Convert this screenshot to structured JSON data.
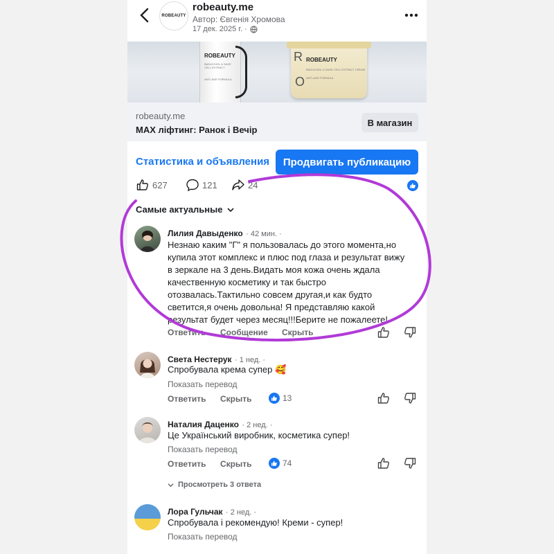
{
  "header": {
    "page_name": "robeauty.me",
    "author": "Автор: Євгенія Хромова",
    "date": "17 дек. 2025 г. ·",
    "logo_text": "ROBEAUTY"
  },
  "banner": {
    "tube_brand": "ROBEAUTY",
    "tube_line1": "BAKUCHIOL & SAGE CELL EXTRACT",
    "tube_line2": "ANTI-AGE FORMULA",
    "jar_brand": "ROBEAUTY",
    "jar_line1": "BAKUCHIOL & SAGE CELL EXTRACT CREAM",
    "jar_line2": "ANTI-AGE FORMULA",
    "jar_letters": [
      "R",
      "O"
    ]
  },
  "link_card": {
    "domain": "robeauty.me",
    "title": "MAX ліфтинг: Ранок і Вечір",
    "button": "В магазин"
  },
  "actions": {
    "stats_link": "Статистика и объявления",
    "promote_button": "Продвигать публикацию"
  },
  "reactions": {
    "likes": "627",
    "comments": "121",
    "shares": "24"
  },
  "sort_label": "Самые актуальные",
  "comments": [
    {
      "name": "Лилия Давыденко",
      "time": "· 42 мин. ·",
      "lines": [
        "Незнаю каким \"Г\" я пользовалась до этого момента,но",
        "купила этот комплекс и плюс под глаза и результат вижу",
        "в зеркале на 3 день.Видать моя кожа очень ждала",
        "качественную косметику и так быстро",
        "отозвалась.Тактильно совсем другая,и как будто",
        "светится,я очень довольна! Я представляю какой",
        "результат будет через месяц!!!Берите не пожалеете!"
      ],
      "actions": [
        "Ответить",
        "Сообщение",
        "Скрыть"
      ]
    },
    {
      "name": "Света Нестерук",
      "time": "· 1 нед. ·",
      "text": "Спробувала крема супер 🥰",
      "translate": "Показать перевод",
      "actions": [
        "Ответить",
        "Скрыть"
      ],
      "likes": "13"
    },
    {
      "name": "Наталия Даценко",
      "time": "· 2 нед. ·",
      "text": "Це Український виробник, косметика супер!",
      "translate": "Показать перевод",
      "actions": [
        "Ответить",
        "Скрыть"
      ],
      "likes": "74",
      "replies": "Просмотреть 3 ответа"
    },
    {
      "name": "Лора Гульчак",
      "time": "· 2 нед. ·",
      "text": "Спробувала і рекомендую! Креми - супер!",
      "translate": "Показать перевод"
    }
  ],
  "colors": {
    "accent": "#1877f2",
    "highlight": "#b13ad8",
    "card_bg": "#f0f2f5",
    "muted": "#65676b"
  },
  "icons": [
    "back-arrow-icon",
    "more-icon",
    "globe-icon",
    "like-icon",
    "comment-icon",
    "share-icon",
    "thumbs-up-icon",
    "thumbs-down-icon",
    "chevron-down-icon"
  ]
}
